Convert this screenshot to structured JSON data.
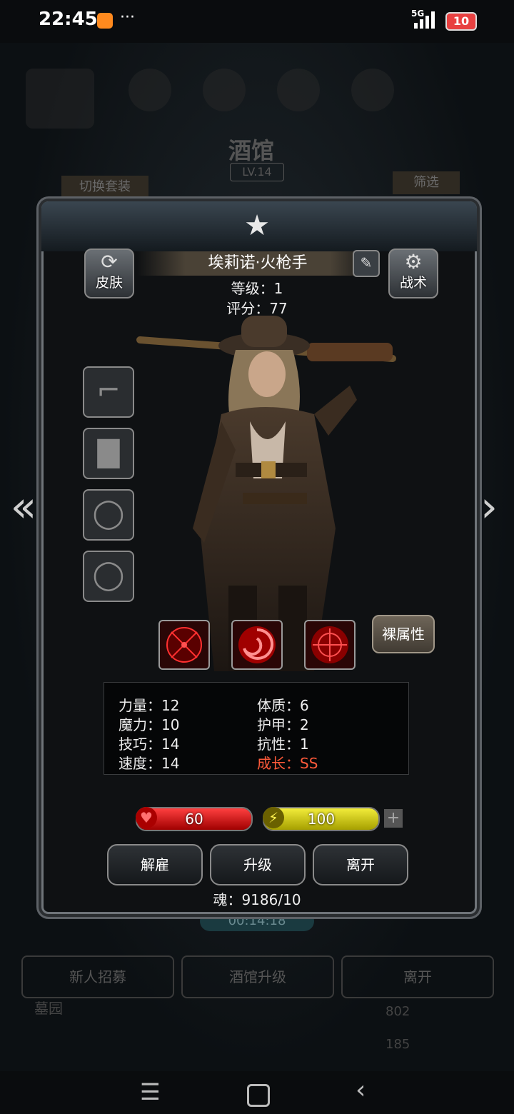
{
  "status_bar": {
    "time": "22:45",
    "dots": "···",
    "network": "5G",
    "battery": "10"
  },
  "capsule": {
    "more": "•••"
  },
  "background": {
    "title": "酒馆",
    "level": "LV.14",
    "switch_outfit": "切换套装",
    "filter": "筛选",
    "timer": "00:14:18",
    "recruit": "新人招募",
    "tavern_upgrade": "酒馆升级",
    "leave": "离开",
    "cemetery": "墓园",
    "count1": "802",
    "count2": "185"
  },
  "hero": {
    "name": "埃莉诺·火枪手",
    "level_text": "等级：1",
    "score_text": "评分：77"
  },
  "buttons": {
    "skin": "皮肤",
    "tactics": "战术",
    "bare_attrs": "裸属性",
    "dismiss": "解雇",
    "upgrade": "升级",
    "leave": "离开"
  },
  "stats": {
    "str": "力量：12",
    "con": "体质：6",
    "mag": "魔力：10",
    "arm": "护甲：2",
    "skl": "技巧：14",
    "res": "抗性：1",
    "spd": "速度：14",
    "grw": "成长：SS"
  },
  "bars": {
    "hp": "60",
    "hp_fraction": 1.0,
    "energy": "100",
    "energy_fraction": 1.0
  },
  "soul": "魂：9186/10",
  "colors": {
    "growth": "#ff5a3a",
    "hp": "#d01010",
    "energy": "#e0d820"
  },
  "icons": {
    "star": "star-icon",
    "skin": "refresh-icon",
    "tactics": "gear-icon",
    "edit": "edit-icon",
    "weapon": "gun-icon",
    "armor": "armor-icon",
    "ring": "ring-icon",
    "left": "double-chevron-left-icon",
    "right": "chevron-right-icon"
  }
}
